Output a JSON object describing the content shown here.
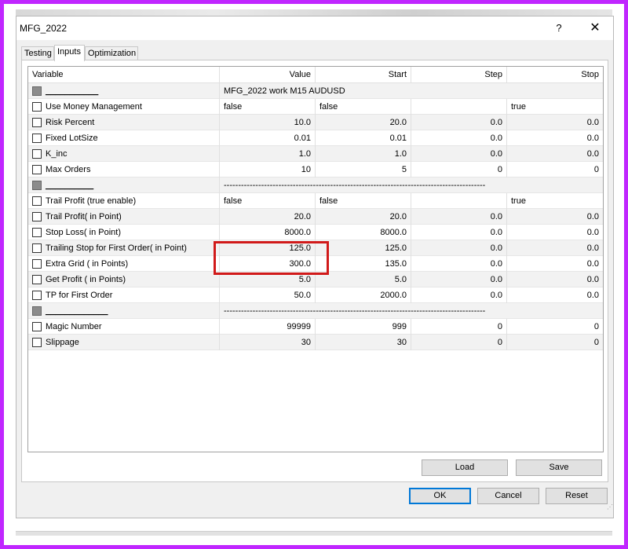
{
  "window": {
    "title": "MFG_2022",
    "help_label": "?",
    "close_label": "✕"
  },
  "tabs": [
    {
      "label": "Testing",
      "active": false
    },
    {
      "label": "Inputs",
      "active": true
    },
    {
      "label": "Optimization",
      "active": false
    }
  ],
  "columns": [
    "Variable",
    "Value",
    "Start",
    "Step",
    "Stop"
  ],
  "rows": [
    {
      "type": "separator",
      "name": "___________",
      "text": "MFG_2022 work M15 AUDUSD"
    },
    {
      "type": "param",
      "name": "Use Money Management",
      "value": "false",
      "start": "false",
      "step": "",
      "stop": "true",
      "bool": true
    },
    {
      "type": "param",
      "name": "Risk Percent",
      "value": "10.0",
      "start": "20.0",
      "step": "0.0",
      "stop": "0.0"
    },
    {
      "type": "param",
      "name": "Fixed LotSize",
      "value": "0.01",
      "start": "0.01",
      "step": "0.0",
      "stop": "0.0"
    },
    {
      "type": "param",
      "name": "K_inc",
      "value": "1.0",
      "start": "1.0",
      "step": "0.0",
      "stop": "0.0"
    },
    {
      "type": "param",
      "name": "Max Orders",
      "value": "10",
      "start": "5",
      "step": "0",
      "stop": "0"
    },
    {
      "type": "separator",
      "name": "__________",
      "text": "-------------------------------------------------------------------------------------------"
    },
    {
      "type": "param",
      "name": "Trail Profit (true enable)",
      "value": "false",
      "start": "false",
      "step": "",
      "stop": "true",
      "bool": true
    },
    {
      "type": "param",
      "name": "Trail Profit( in Point)",
      "value": "20.0",
      "start": "20.0",
      "step": "0.0",
      "stop": "0.0"
    },
    {
      "type": "param",
      "name": "Stop Loss( in Point)",
      "value": "8000.0",
      "start": "8000.0",
      "step": "0.0",
      "stop": "0.0"
    },
    {
      "type": "param",
      "name": "Trailing Stop for First Order( in Point)",
      "value": "125.0",
      "start": "125.0",
      "step": "0.0",
      "stop": "0.0"
    },
    {
      "type": "param",
      "name": "Extra Grid ( in Points)",
      "value": "300.0",
      "start": "135.0",
      "step": "0.0",
      "stop": "0.0"
    },
    {
      "type": "param",
      "name": "Get Profit ( in Points)",
      "value": "5.0",
      "start": "5.0",
      "step": "0.0",
      "stop": "0.0"
    },
    {
      "type": "param",
      "name": "TP for First Order",
      "value": "50.0",
      "start": "2000.0",
      "step": "0.0",
      "stop": "0.0"
    },
    {
      "type": "separator",
      "name": "_____________",
      "text": "-------------------------------------------------------------------------------------------"
    },
    {
      "type": "param",
      "name": "Magic Number",
      "value": "99999",
      "start": "999",
      "step": "0",
      "stop": "0"
    },
    {
      "type": "param",
      "name": "Slippage",
      "value": "30",
      "start": "30",
      "step": "0",
      "stop": "0"
    }
  ],
  "buttons": {
    "load": "Load",
    "save": "Save",
    "ok": "OK",
    "cancel": "Cancel",
    "reset": "Reset"
  },
  "colors": {
    "highlight": "#d11a1a",
    "frame": "#c026ff",
    "default_button": "#0078d7"
  }
}
